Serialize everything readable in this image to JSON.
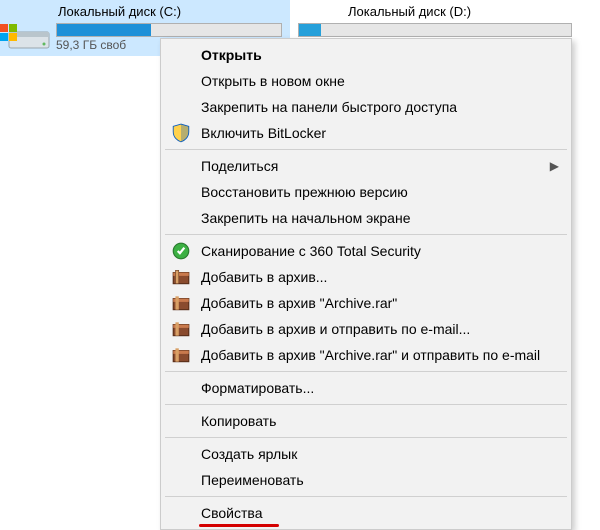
{
  "drives": {
    "c": {
      "label": "Локальный диск (C:)",
      "free": "59,3 ГБ своб",
      "fill_pct": 42
    },
    "d": {
      "label": "Локальный диск (D:)",
      "fill_pct": 8
    }
  },
  "menu": {
    "open": "Открыть",
    "open_new_window": "Открыть в новом окне",
    "pin_quick_access": "Закрепить на панели быстрого доступа",
    "bitlocker": "Включить BitLocker",
    "share": "Поделиться",
    "restore_previous": "Восстановить прежнюю версию",
    "pin_start": "Закрепить на начальном экране",
    "scan_360": "Сканирование с 360 Total Security",
    "add_archive": "Добавить в архив...",
    "add_archive_rar": "Добавить в архив \"Archive.rar\"",
    "add_archive_email": "Добавить в архив и отправить по e-mail...",
    "add_archive_rar_email": "Добавить в архив \"Archive.rar\" и отправить по e-mail",
    "format": "Форматировать...",
    "copy": "Копировать",
    "create_shortcut": "Создать ярлык",
    "rename": "Переименовать",
    "properties": "Свойства"
  }
}
